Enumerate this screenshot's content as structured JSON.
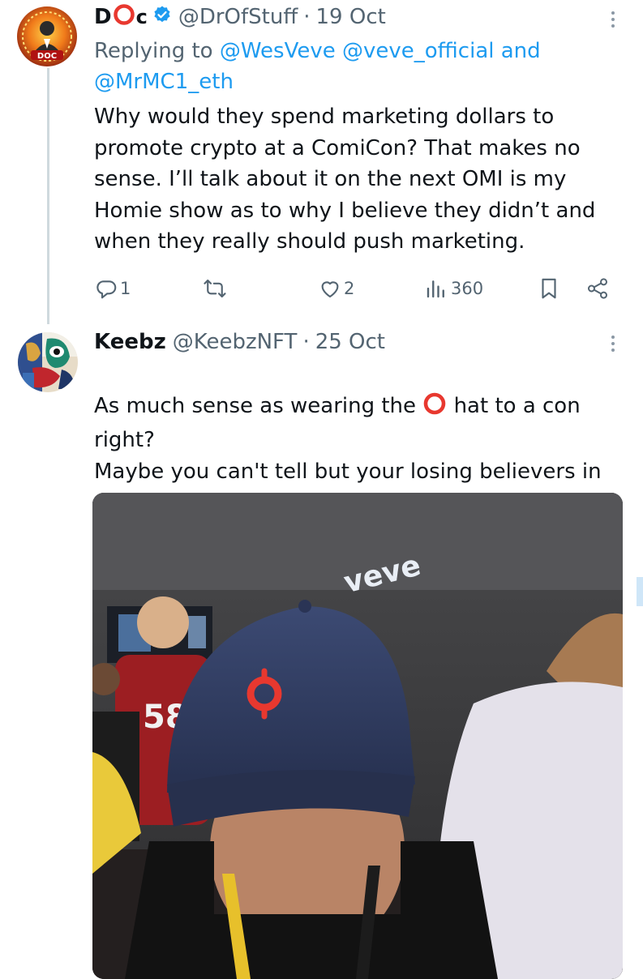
{
  "tweet1": {
    "display_name": "D",
    "display_name_suffix": "c",
    "handle": "@DrOfStuff",
    "separator": "·",
    "date": "19 Oct",
    "avatar_badge": "DOC",
    "reply_prefix": "Replying to ",
    "reply_mentions": [
      "@WesVeve",
      "@veve_official"
    ],
    "reply_and": " and",
    "reply_mention_last": "@MrMC1_eth",
    "text": "Why would they spend marketing dollars to\npromote crypto at a ComiCon?  That makes no\nsense. I’ll talk about it on the next OMI is my\nHomie show as to why I believe they didn’t and\nwhen they really should push marketing.",
    "stats": {
      "replies": "1",
      "likes": "2",
      "views": "360"
    }
  },
  "tweet2": {
    "display_name": "Keebz",
    "handle": "@KeebzNFT",
    "separator": "·",
    "date": "25 Oct",
    "text_before_emoji": "As much sense as wearing the ",
    "text_after_emoji": " hat to a con",
    "text_rest": "right?\nMaybe you can't tell but your losing believers in\nanything you say daily.",
    "media_logo_text": "veve"
  },
  "colors": {
    "accent": "#1d9bf0",
    "text": "#0f1419",
    "muted": "#536471",
    "thread_line": "#cfd9de",
    "omi_red": "#e8382f"
  },
  "icons": [
    "verified-badge-icon",
    "more-icon",
    "reply-icon",
    "retweet-icon",
    "like-icon",
    "views-icon",
    "bookmark-icon",
    "share-icon",
    "omi-logo-icon"
  ]
}
